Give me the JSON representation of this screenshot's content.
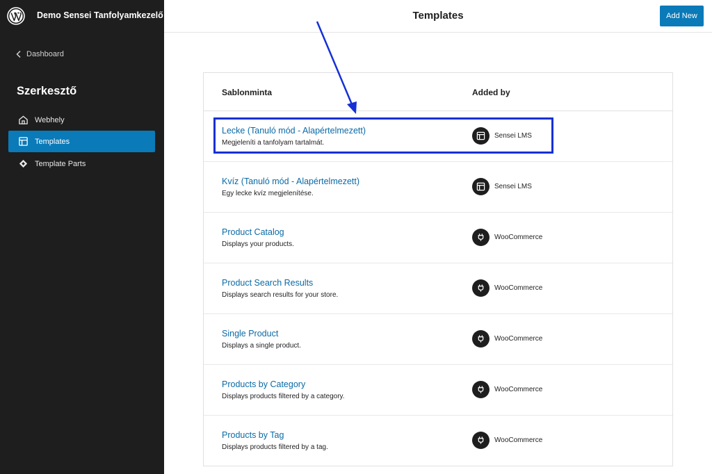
{
  "sidebar": {
    "site_title": "Demo Sensei Tanfolyamkezelő",
    "back_label": "Dashboard",
    "section_title": "Szerkesztő",
    "items": [
      {
        "label": "Webhely",
        "icon": "home-icon",
        "active": false
      },
      {
        "label": "Templates",
        "icon": "layout-icon",
        "active": true
      },
      {
        "label": "Template Parts",
        "icon": "symbol-icon",
        "active": false
      }
    ]
  },
  "header": {
    "title": "Templates",
    "add_new_label": "Add New"
  },
  "table": {
    "columns": [
      "Sablonminta",
      "Added by"
    ],
    "rows": [
      {
        "title": "Lecke (Tanuló mód - Alapértelmezett)",
        "description": "Megjeleníti a tanfolyam tartalmát.",
        "added_by": "Sensei LMS",
        "icon": "layout-icon"
      },
      {
        "title": "Kvíz (Tanuló mód - Alapértelmezett)",
        "description": "Egy lecke kvíz megjelenítése.",
        "added_by": "Sensei LMS",
        "icon": "layout-icon"
      },
      {
        "title": "Product Catalog",
        "description": "Displays your products.",
        "added_by": "WooCommerce",
        "icon": "plugin-icon"
      },
      {
        "title": "Product Search Results",
        "description": "Displays search results for your store.",
        "added_by": "WooCommerce",
        "icon": "plugin-icon"
      },
      {
        "title": "Single Product",
        "description": "Displays a single product.",
        "added_by": "WooCommerce",
        "icon": "plugin-icon"
      },
      {
        "title": "Products by Category",
        "description": "Displays products filtered by a category.",
        "added_by": "WooCommerce",
        "icon": "plugin-icon"
      },
      {
        "title": "Products by Tag",
        "description": "Displays products filtered by a tag.",
        "added_by": "WooCommerce",
        "icon": "plugin-icon"
      }
    ]
  },
  "colors": {
    "sidebar_bg": "#1e1e1e",
    "accent": "#0a7ab8",
    "link": "#0a6aa6",
    "annotation": "#1530d6"
  }
}
